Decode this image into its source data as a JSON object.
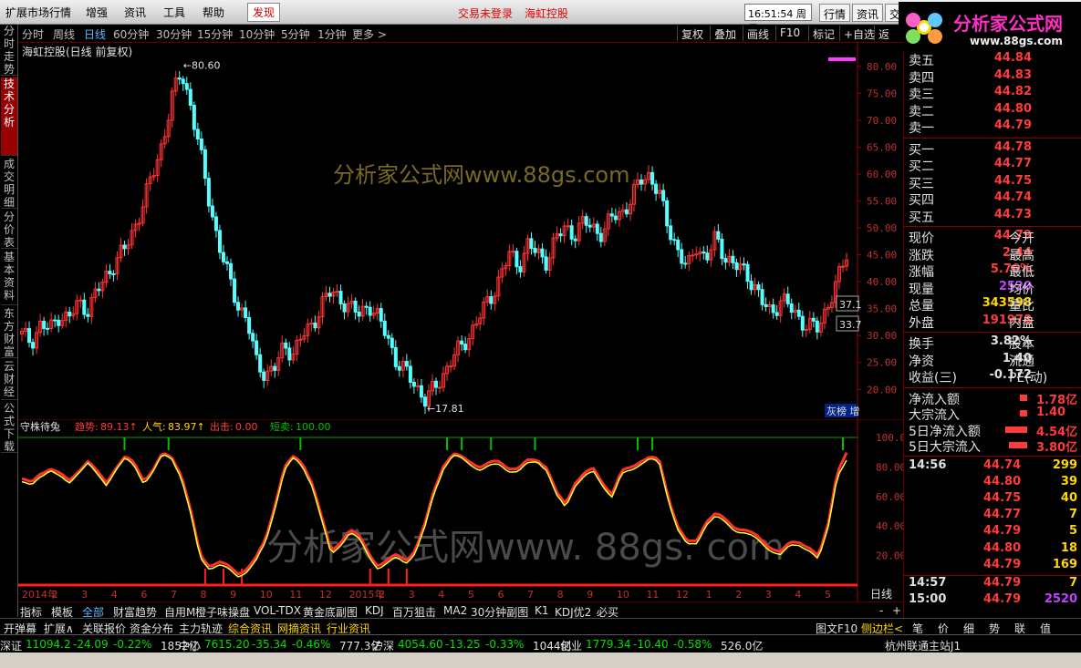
{
  "menubar": {
    "items": [
      "扩展市场行情",
      "增强",
      "资讯",
      "工具",
      "帮助",
      "发现"
    ],
    "center": [
      "交易未登录",
      "海虹控股"
    ],
    "clock": "16:51:54 周日",
    "buttons": [
      "行情",
      "资讯",
      "交"
    ]
  },
  "logo": {
    "title": "分析家公式网",
    "url": "www.88gs.com"
  },
  "left_tabs": [
    "分时走势",
    "技术分析",
    "成交明细",
    "分价表",
    "基本资料",
    "东方财富",
    "云财经",
    "公式下载"
  ],
  "period_bar": {
    "items": [
      "分时",
      "周线",
      "日线",
      "60分钟",
      "30分钟",
      "15分钟",
      "10分钟",
      "5分钟",
      "1分钟",
      "更多 >"
    ],
    "active": "日线",
    "tools": [
      "复权",
      "叠加",
      "画线",
      "F10",
      "标记",
      "+自选",
      "返回"
    ]
  },
  "main_chart": {
    "title": "海虹控股(日线 前复权)",
    "high_label": "80.60",
    "low_label": "17.81",
    "price_boxes": [
      "37.1",
      "33.7"
    ],
    "watermark": "分析家公式网www.88gs.com",
    "right_tag": "灰榜 增",
    "ylim": [
      17,
      82
    ],
    "y_ticks": [
      "80.00",
      "75.00",
      "70.00",
      "65.00",
      "60.00",
      "55.00",
      "50.00",
      "45.00",
      "40.00",
      "35.00",
      "30.00",
      "25.00",
      "20.00"
    ],
    "colors": {
      "up": "#ff3333",
      "down": "#54ffff"
    }
  },
  "indicator": {
    "name": "守株待兔",
    "trend_label": "趋势:",
    "trend_val": "89.13",
    "pop_label": "人气:",
    "pop_val": "83.97",
    "out_label": "出击:",
    "out_val": "0.00",
    "short_label": "短卖:",
    "short_val": "100.00",
    "watermark": "分析家公式网www. 88gs. com",
    "y_ticks": [
      "100.00",
      "80.00",
      "60.00",
      "40.00",
      "20.00"
    ],
    "x_labels": [
      "2014年",
      "2",
      "3",
      "4",
      "6",
      "7",
      "8",
      "9",
      "10",
      "11",
      "12",
      "2015年",
      "2",
      "3",
      "4",
      "5",
      "6",
      "7",
      "8",
      "9",
      "10",
      "11",
      "12",
      "1",
      "2",
      "3",
      "4",
      "5"
    ],
    "period": "日线"
  },
  "bottom_tabs": [
    "指标",
    "模板",
    "全部",
    "财富趋势",
    "自用M",
    "橙子味操盘",
    "VOL-TDX",
    "黄金底副图",
    "KDJ",
    "百万狙击",
    "MA2",
    "30分钟副图",
    "K1",
    "KDJ优2",
    "必买"
  ],
  "toolbar2": {
    "items": [
      "开弹幕",
      "扩展∧",
      "关联报价",
      "资金分布",
      "主力轨迹",
      "综合资讯",
      "网摘资讯",
      "行业资讯"
    ],
    "right": [
      "图文F10",
      "侧边栏<",
      "笔",
      "价",
      "细",
      "势",
      "联",
      "值"
    ]
  },
  "ticker": [
    {
      "label": "深证",
      "value": "11094.2",
      "chg": "-24.09",
      "pct": "-0.22%",
      "amt": "1852亿"
    },
    {
      "label": "中小",
      "value": "7615.20",
      "chg": "-35.34",
      "pct": "-0.46%",
      "amt": "777.3亿"
    },
    {
      "label": "沪深",
      "value": "4054.60",
      "chg": "-13.25",
      "pct": "-0.33%",
      "amt": "1044亿"
    },
    {
      "label": "创业",
      "value": "1779.34",
      "chg": "-10.40",
      "pct": "-0.58%",
      "amt": "526.0亿"
    }
  ],
  "ticker_station": "杭州联通主站J1",
  "quote": {
    "asks": [
      {
        "label": "卖五",
        "price": "44.84"
      },
      {
        "label": "卖四",
        "price": "44.83"
      },
      {
        "label": "卖三",
        "price": "44.82"
      },
      {
        "label": "卖二",
        "price": "44.80"
      },
      {
        "label": "卖一",
        "price": "44.79"
      }
    ],
    "bids": [
      {
        "label": "买一",
        "price": "44.78"
      },
      {
        "label": "买二",
        "price": "44.77"
      },
      {
        "label": "买三",
        "price": "44.75"
      },
      {
        "label": "买四",
        "price": "44.74"
      },
      {
        "label": "买五",
        "price": "44.73"
      }
    ],
    "stats": [
      {
        "label": "现价",
        "value": "44.79",
        "label2": "今开"
      },
      {
        "label": "涨跌",
        "value": "2.44",
        "label2": "最高"
      },
      {
        "label": "涨幅",
        "value": "5.76%",
        "label2": "最低"
      },
      {
        "label": "现量",
        "value": "2520",
        "label2": "均价"
      },
      {
        "label": "总量",
        "value": "343598",
        "label2": "量比"
      },
      {
        "label": "外盘",
        "value": "191978",
        "label2": "内盘"
      }
    ],
    "stats2": [
      {
        "label": "换手",
        "value": "3.82%",
        "label2": "股本"
      },
      {
        "label": "净资",
        "value": "1.40",
        "label2": "流通"
      },
      {
        "label": "收益(三)",
        "value": "-0.172",
        "label2": "PE(动)"
      }
    ],
    "flows": [
      {
        "label": "净流入额",
        "value": "1.78亿",
        "bar": 0.2
      },
      {
        "label": "大宗流入",
        "value": "1.40",
        "bar": 0.2
      },
      {
        "label": "5日净流入额",
        "value": "4.54亿",
        "bar": 0.6
      },
      {
        "label": "5日大宗流入",
        "value": "3.80亿",
        "bar": 0.5
      }
    ],
    "ticks": [
      {
        "time": "14:56",
        "price": "44.74",
        "vol": "299"
      },
      {
        "time": "",
        "price": "44.80",
        "vol": "39"
      },
      {
        "time": "",
        "price": "44.75",
        "vol": "40"
      },
      {
        "time": "",
        "price": "44.77",
        "vol": "7"
      },
      {
        "time": "",
        "price": "44.79",
        "vol": "5"
      },
      {
        "time": "",
        "price": "44.80",
        "vol": "18"
      },
      {
        "time": "",
        "price": "44.79",
        "vol": "169"
      },
      {
        "time": "14:57",
        "price": "44.79",
        "vol": "7"
      },
      {
        "time": "15:00",
        "price": "44.79",
        "vol": "2520"
      }
    ]
  },
  "chart_data": {
    "type": "candlestick",
    "title": "海虹控股(日线 前复权)",
    "x_labels": [
      "2014年",
      "2",
      "3",
      "4",
      "6",
      "7",
      "8",
      "9",
      "10",
      "11",
      "12",
      "2015年",
      "2",
      "3",
      "4",
      "5",
      "6",
      "7",
      "8",
      "9",
      "10",
      "11",
      "12",
      "1",
      "2",
      "3",
      "4",
      "5"
    ],
    "close_path": [
      30,
      29,
      32,
      31,
      34,
      33,
      36,
      35,
      38,
      41,
      44,
      46,
      50,
      55,
      60,
      66,
      74,
      79,
      73,
      64,
      55,
      47,
      41,
      36,
      33,
      25,
      23,
      24,
      28,
      27,
      30,
      32,
      36,
      38,
      37,
      35,
      34,
      36,
      33,
      30,
      25,
      23,
      21,
      18,
      20,
      23,
      26,
      28,
      31,
      34,
      37,
      41,
      45,
      43,
      47,
      45,
      44,
      48,
      50,
      49,
      51,
      50,
      49,
      52,
      53,
      55,
      59,
      60,
      56,
      50,
      46,
      42,
      47,
      44,
      48,
      45,
      43,
      42,
      40,
      36,
      34,
      37,
      35,
      33,
      32,
      31,
      36,
      40,
      44.79
    ],
    "ylim": [
      17,
      82
    ],
    "high": 80.6,
    "low": 17.81,
    "indicator": {
      "name": "守株待兔",
      "ylim": [
        0,
        100
      ],
      "trend": [
        72,
        68,
        76,
        80,
        75,
        70,
        78,
        84,
        76,
        70,
        80,
        86,
        82,
        72,
        78,
        88,
        87,
        76,
        50,
        20,
        14,
        16,
        12,
        8,
        12,
        18,
        30,
        55,
        80,
        86,
        82,
        70,
        45,
        22,
        30,
        38,
        32,
        22,
        14,
        16,
        20,
        18,
        24,
        40,
        65,
        82,
        88,
        86,
        84,
        80,
        82,
        84,
        80,
        78,
        84,
        86,
        80,
        62,
        55,
        70,
        75,
        78,
        70,
        62,
        76,
        80,
        85,
        86,
        84,
        60,
        40,
        28,
        30,
        44,
        48,
        44,
        40,
        38,
        34,
        30,
        26,
        22,
        28,
        30,
        26,
        18,
        40,
        78,
        89.13
      ],
      "popularity": [
        70,
        66,
        74,
        79,
        73,
        68,
        77,
        83,
        74,
        68,
        79,
        85,
        80,
        70,
        77,
        87,
        86,
        74,
        48,
        18,
        12,
        14,
        10,
        6,
        10,
        16,
        28,
        53,
        78,
        85,
        80,
        68,
        43,
        20,
        28,
        36,
        30,
        20,
        12,
        14,
        18,
        16,
        22,
        38,
        63,
        80,
        87,
        85,
        82,
        78,
        80,
        82,
        78,
        76,
        82,
        85,
        78,
        60,
        53,
        68,
        73,
        76,
        68,
        60,
        74,
        78,
        83,
        85,
        82,
        58,
        38,
        26,
        28,
        42,
        46,
        42,
        38,
        36,
        32,
        28,
        24,
        20,
        26,
        28,
        24,
        16,
        38,
        75,
        83.97
      ]
    }
  }
}
